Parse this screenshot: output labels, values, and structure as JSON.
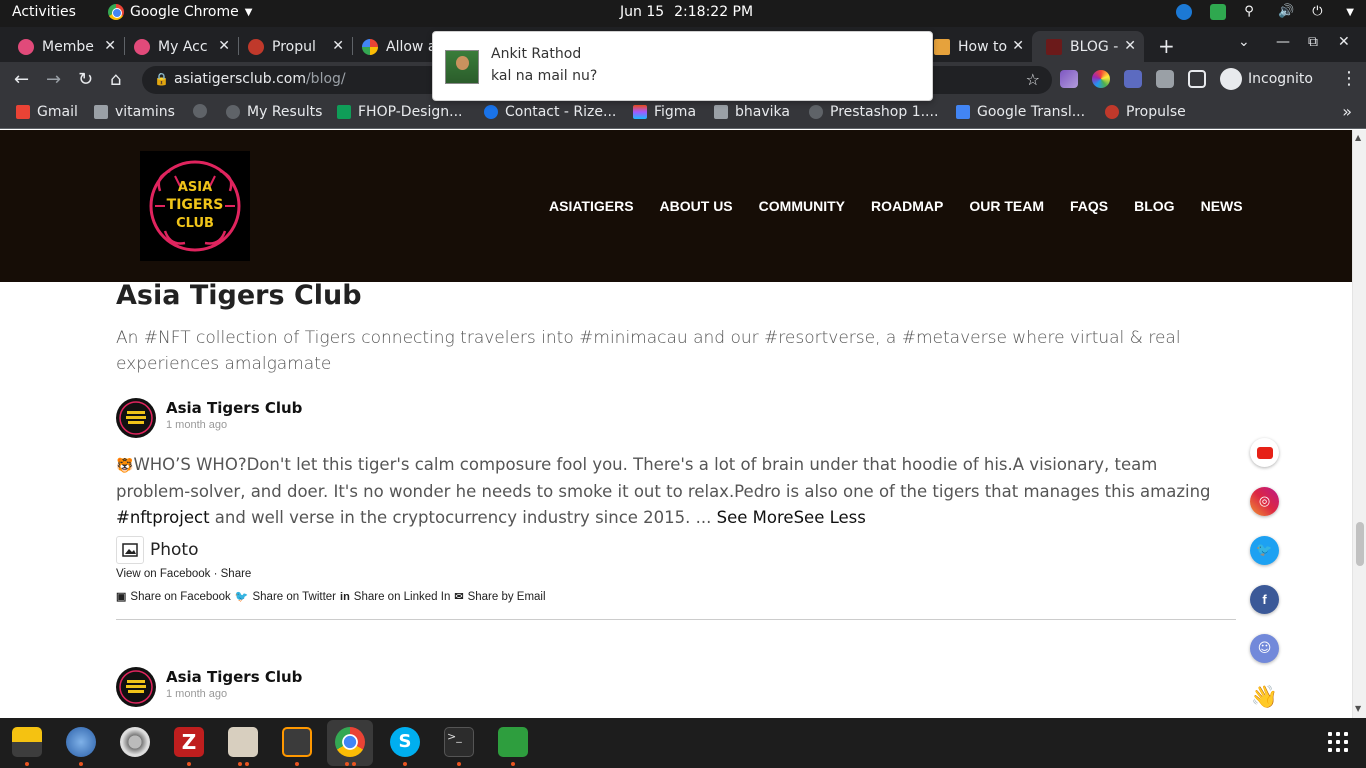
{
  "topbar": {
    "activities": "Activities",
    "app_name": "Google Chrome",
    "date": "Jun 15",
    "time": "2:18:22 PM"
  },
  "tabs": [
    {
      "label": "Membe",
      "active": false
    },
    {
      "label": "My Acc",
      "active": false
    },
    {
      "label": "Propul",
      "active": false
    },
    {
      "label": "Allow a",
      "active": false
    },
    {
      "label": "How to",
      "active": false
    },
    {
      "label": "BLOG -",
      "active": true
    }
  ],
  "toolbar": {
    "url_host": "asiatigersclub.com",
    "url_path": "/blog/",
    "incognito_label": "Incognito"
  },
  "bookmarks": [
    {
      "label": "Gmail"
    },
    {
      "label": "vitamins"
    },
    {
      "label": ""
    },
    {
      "label": "My Results"
    },
    {
      "label": "FHOP-Design..."
    },
    {
      "label": "Contact - Rize..."
    },
    {
      "label": "Figma"
    },
    {
      "label": "bhavika"
    },
    {
      "label": "Prestashop 1...."
    },
    {
      "label": "Google Transl..."
    },
    {
      "label": "Propulse"
    }
  ],
  "notification": {
    "sender": "Ankit Rathod",
    "message": "kal na mail nu?"
  },
  "site": {
    "logo_text": [
      "ASIA",
      "TIGERS",
      "CLUB"
    ],
    "nav": [
      "ASIATIGERS",
      "ABOUT US",
      "COMMUNITY",
      "ROADMAP",
      "OUR TEAM",
      "FAQS",
      "BLOG",
      "NEWS"
    ]
  },
  "feed": {
    "title": "Asia Tigers Club",
    "description": "An #NFT collection of Tigers connecting travelers into #minimacau and our #resortverse, a #metaverse where virtual & real experiences amalgamate"
  },
  "posts": [
    {
      "author": "Asia Tigers Club",
      "time": "1 month ago",
      "text_emoji": "🐯",
      "text_part1": "WHO’S WHO?Don't let this tiger's calm composure fool you. There's a lot of brain under that hoodie of his.A visionary, team problem-solver, and doer. It's no wonder he needs to smoke it out to relax.Pedro is also one of the tigers that manages this amazing ",
      "text_hashtag": "#nftproject",
      "text_part2": " and well verse in the cryptocurrency industry since 2015. ... ",
      "see_more": "See MoreSee Less",
      "photo_label": "Photo",
      "view_on_facebook": "View on Facebook",
      "separator": " · ",
      "share_label": "Share",
      "share_facebook": "Share on Facebook",
      "share_twitter": "Share on Twitter",
      "share_linkedin": "Share on Linked In",
      "share_email": "Share by Email"
    },
    {
      "author": "Asia Tigers Club",
      "time": "1 month ago"
    }
  ],
  "social": [
    {
      "name": "youtube",
      "color": "#e62117"
    },
    {
      "name": "instagram",
      "color": "#c13584"
    },
    {
      "name": "twitter",
      "color": "#1da1f2"
    },
    {
      "name": "facebook",
      "color": "#3b5998"
    },
    {
      "name": "discord",
      "color": "#7289da"
    }
  ]
}
